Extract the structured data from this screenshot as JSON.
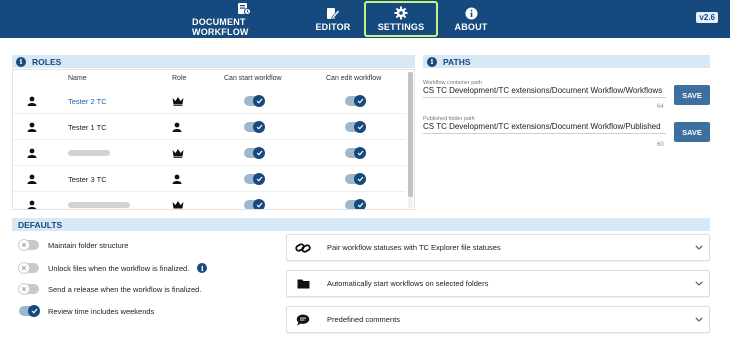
{
  "nav": {
    "items": [
      {
        "label": "DOCUMENT WORKFLOW",
        "icon": "document-workflow-icon",
        "active": false
      },
      {
        "label": "EDITOR",
        "icon": "editor-icon",
        "active": false
      },
      {
        "label": "SETTINGS",
        "icon": "gear-icon",
        "active": true
      },
      {
        "label": "ABOUT",
        "icon": "info-icon",
        "active": false
      }
    ],
    "version": "v2.6"
  },
  "colors": {
    "brand": "#164a7e",
    "active_outline": "#c9f27a",
    "section_bg": "#d9e8f5",
    "save_button": "#3d6f9f"
  },
  "roles": {
    "title": "ROLES",
    "columns": {
      "name": "Name",
      "role": "Role",
      "can_start": "Can start workflow",
      "can_edit": "Can edit workflow"
    },
    "rows": [
      {
        "name": "Tester 2 TC",
        "hidden_name": false,
        "role_icon": "crown-icon",
        "can_start": true,
        "can_edit": true
      },
      {
        "name": "Tester 1 TC",
        "hidden_name": false,
        "role_icon": "user-icon",
        "can_start": true,
        "can_edit": true
      },
      {
        "name": "",
        "hidden_name": true,
        "role_icon": "crown-icon",
        "can_start": true,
        "can_edit": true
      },
      {
        "name": "Tester 3 TC",
        "hidden_name": false,
        "role_icon": "user-icon",
        "can_start": true,
        "can_edit": true
      },
      {
        "name": "",
        "hidden_name": true,
        "role_icon": "crown-icon",
        "can_start": true,
        "can_edit": true
      }
    ]
  },
  "paths": {
    "title": "PATHS",
    "workflow_container": {
      "label": "Workflow container path",
      "value": "CS TC Development/TC extensions/Document Workflow/Workflows",
      "count": "64",
      "save": "SAVE"
    },
    "published_folder": {
      "label": "Published folder path",
      "value": "CS TC Development/TC extensions/Document Workflow/Published",
      "count": "60",
      "save": "SAVE"
    }
  },
  "defaults": {
    "title": "DEFAULTS",
    "options": [
      {
        "label": "Maintain folder structure",
        "on": false,
        "has_info": false
      },
      {
        "label": "Unlock files when the workflow is finalized.",
        "on": false,
        "has_info": true
      },
      {
        "label": "Send a release when the workflow is finalized.",
        "on": false,
        "has_info": false
      },
      {
        "label": "Review time includes weekends",
        "on": true,
        "has_info": false
      }
    ],
    "panels": [
      {
        "label": "Pair workflow statuses with TC Explorer file statuses",
        "icon": "link-icon"
      },
      {
        "label": "Automatically start workflows on selected folders",
        "icon": "folder-icon"
      },
      {
        "label": "Predefined comments",
        "icon": "comment-icon"
      }
    ]
  }
}
